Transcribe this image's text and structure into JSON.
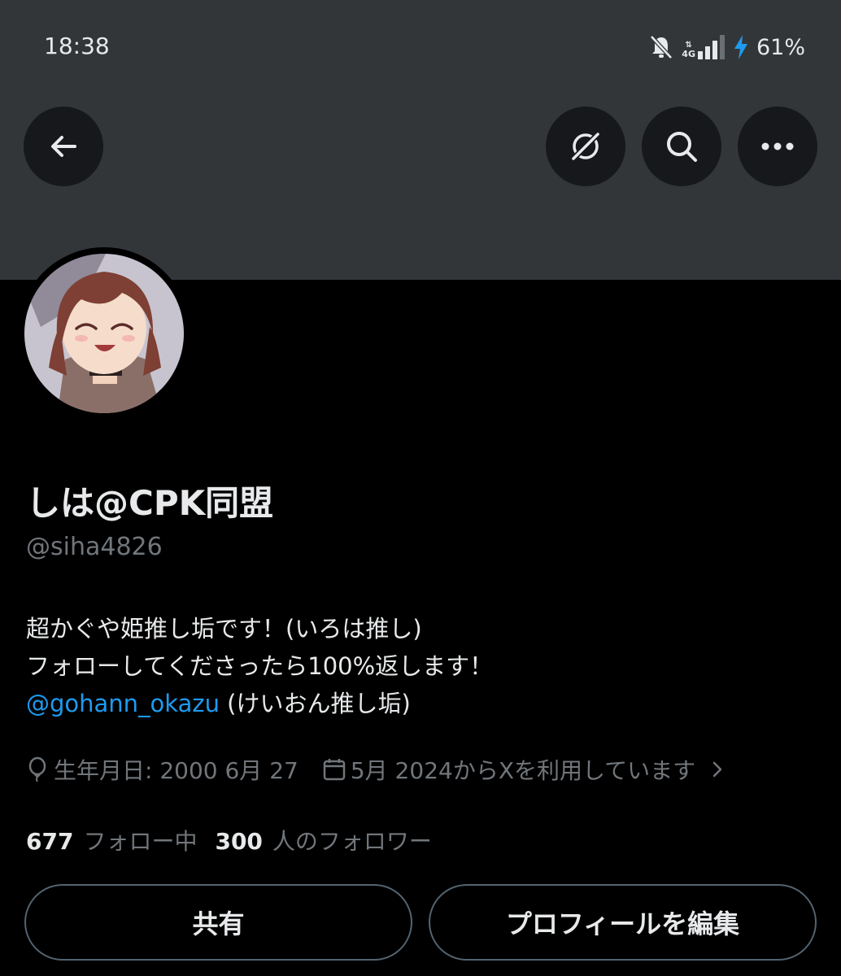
{
  "status_bar": {
    "time": "18:38",
    "network": "4G",
    "battery": "61%",
    "icons": [
      "bell-off-icon",
      "signal-icon",
      "charging-icon"
    ]
  },
  "nav": {
    "icons": [
      "back-arrow-icon",
      "grok-icon",
      "search-icon",
      "more-icon"
    ]
  },
  "profile": {
    "display_name": "しは@CPK同盟",
    "handle": "@siha4826",
    "bio_line1": "超かぐや姫推し垢です！(いろは推し)",
    "bio_line2": "フォローしてくださったら100%返します！",
    "bio_mention": "@gohann_okazu",
    "bio_line3_rest": " (けいおん推し垢)",
    "birthday": "生年月日: 2000 6月 27",
    "joined": "5月 2024からXを利用しています",
    "following_count": "677",
    "following_label": "フォロー中",
    "followers_count": "300",
    "followers_label": "人のフォロワー"
  },
  "actions": {
    "share_label": "共有",
    "edit_label": "プロフィールを編集"
  },
  "colors": {
    "background": "#000000",
    "header": "#333639",
    "accent": "#1d9bf0",
    "muted": "#71767b",
    "button_bg": "#16181c"
  }
}
